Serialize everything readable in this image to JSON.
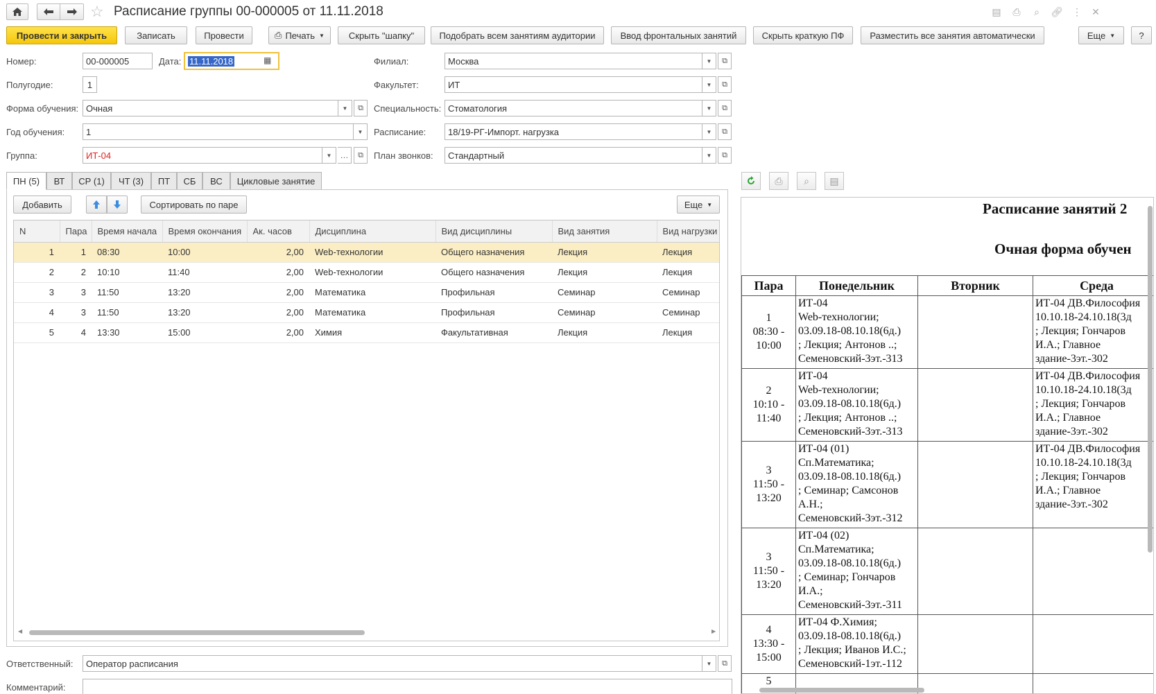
{
  "window": {
    "title": "Расписание группы 00-000005 от 11.11.2018"
  },
  "toolbar": {
    "post_close": "Провести и закрыть",
    "save": "Записать",
    "post": "Провести",
    "print": "Печать",
    "hide_header": "Скрыть \"шапку\"",
    "pick_rooms": "Подобрать всем занятиям аудитории",
    "frontal": "Ввод фронтальных занятий",
    "hide_pf": "Скрыть краткую ПФ",
    "auto_place": "Разместить все занятия автоматически",
    "more": "Еще",
    "help": "?"
  },
  "form": {
    "number_label": "Номер:",
    "number": "00-000005",
    "date_label": "Дата:",
    "date": "11.11.2018",
    "halfyear_label": "Полугодие:",
    "halfyear": "1",
    "eduform_label": "Форма обучения:",
    "eduform": "Очная",
    "year_label": "Год обучения:",
    "year": "1",
    "group_label": "Группа:",
    "group": "ИТ-04",
    "branch_label": "Филиал:",
    "branch": "Москва",
    "faculty_label": "Факультет:",
    "faculty": "ИТ",
    "specialty_label": "Специальность:",
    "specialty": "Стоматология",
    "schedule_label": "Расписание:",
    "schedule": "18/19-РГ-Импорт. нагрузка",
    "bells_label": "План звонков:",
    "bells": "Стандартный",
    "responsible_label": "Ответственный:",
    "responsible": "Оператор расписания",
    "comment_label": "Комментарий:",
    "comment": ""
  },
  "tabs": [
    "ПН (5)",
    "ВТ",
    "СР (1)",
    "ЧТ (3)",
    "ПТ",
    "СБ",
    "ВС",
    "Цикловые занятие"
  ],
  "table_toolbar": {
    "add": "Добавить",
    "sort": "Сортировать по паре",
    "more": "Еще"
  },
  "grid": {
    "columns": [
      "N",
      "Пара",
      "Время начала",
      "Время окончания",
      "Ак. часов",
      "Дисциплина",
      "Вид дисциплины",
      "Вид занятия",
      "Вид нагрузки"
    ],
    "rows": [
      [
        "1",
        "1",
        "08:30",
        "10:00",
        "2,00",
        "Web-технологии",
        "Общего назначения",
        "Лекция",
        "Лекция"
      ],
      [
        "2",
        "2",
        "10:10",
        "11:40",
        "2,00",
        "Web-технологии",
        "Общего назначения",
        "Лекция",
        "Лекция"
      ],
      [
        "3",
        "3",
        "11:50",
        "13:20",
        "2,00",
        "Математика",
        "Профильная",
        "Семинар",
        "Семинар"
      ],
      [
        "4",
        "3",
        "11:50",
        "13:20",
        "2,00",
        "Математика",
        "Профильная",
        "Семинар",
        "Семинар"
      ],
      [
        "5",
        "4",
        "13:30",
        "15:00",
        "2,00",
        "Химия",
        "Факультативная",
        "Лекция",
        "Лекция"
      ]
    ]
  },
  "preview": {
    "title": "Расписание занятий 2",
    "subtitle": "Очная форма обучен",
    "headers": [
      "Пара",
      "Понедельник",
      "Вторник",
      "Среда"
    ],
    "rows": [
      {
        "para": [
          "1",
          "08:30 -",
          "10:00"
        ],
        "mon": [
          "ИТ-04",
          "Web-технологии;",
          "03.09.18-08.10.18(6д.)",
          "; Лекция; Антонов ..;",
          "Семеновский-3эт.-313"
        ],
        "wed": [
          "ИТ-04 ДВ.Философия",
          "10.10.18-24.10.18(3д",
          "; Лекция; Гончаров",
          "И.А.; Главное",
          "здание-3эт.-302"
        ]
      },
      {
        "para": [
          "2",
          "10:10 -",
          "11:40"
        ],
        "mon": [
          "ИТ-04",
          "Web-технологии;",
          "03.09.18-08.10.18(6д.)",
          "; Лекция; Антонов ..;",
          "Семеновский-3эт.-313"
        ],
        "wed": [
          "ИТ-04 ДВ.Философия",
          "10.10.18-24.10.18(3д",
          "; Лекция; Гончаров",
          "И.А.; Главное",
          "здание-3эт.-302"
        ]
      },
      {
        "para": [
          "3",
          "11:50 -",
          "13:20"
        ],
        "mon": [
          "ИТ-04 (01)",
          "Сп.Математика;",
          "03.09.18-08.10.18(6д.)",
          "; Семинар; Самсонов",
          "А.Н.;",
          "Семеновский-3эт.-312"
        ],
        "wed": [
          "ИТ-04 ДВ.Философия",
          "10.10.18-24.10.18(3д",
          "; Лекция; Гончаров",
          "И.А.; Главное",
          "здание-3эт.-302"
        ]
      },
      {
        "para": [
          "3",
          "11:50 -",
          "13:20"
        ],
        "mon": [
          "ИТ-04 (02)",
          "Сп.Математика;",
          "03.09.18-08.10.18(6д.)",
          "; Семинар; Гончаров",
          "И.А.;",
          "Семеновский-3эт.-311"
        ],
        "wed": []
      },
      {
        "para": [
          "4",
          "13:30 -",
          "15:00"
        ],
        "mon": [
          "ИТ-04 Ф.Химия;",
          "03.09.18-08.10.18(6д.)",
          "; Лекция; Иванов И.С.;",
          "Семеновский-1эт.-112"
        ],
        "wed": []
      },
      {
        "para": [
          "5"
        ],
        "mon": [],
        "wed": []
      }
    ]
  }
}
